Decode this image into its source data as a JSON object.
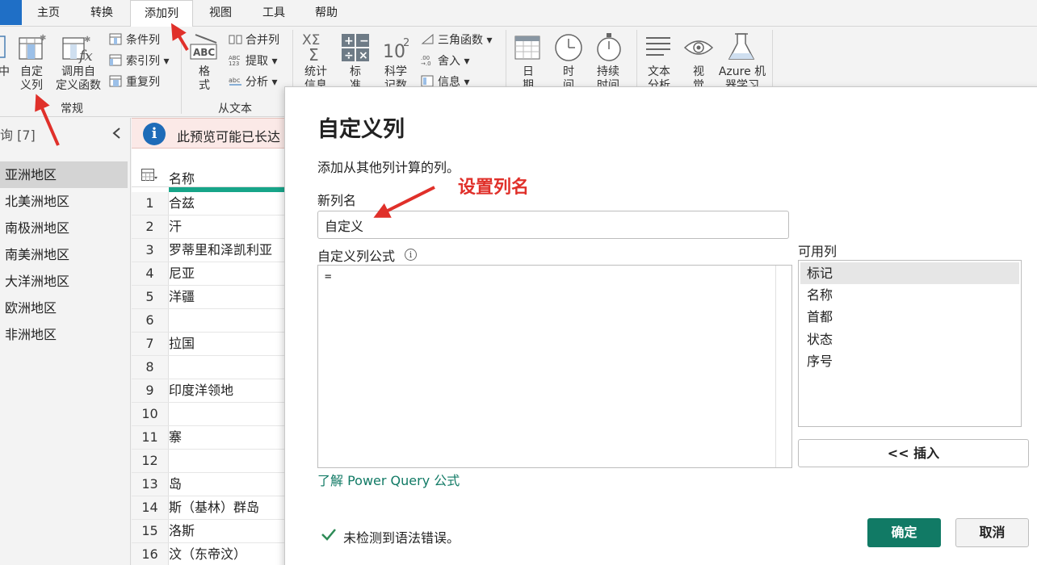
{
  "tabs": [
    {
      "label": "主页"
    },
    {
      "label": "转换"
    },
    {
      "label": "添加列"
    },
    {
      "label": "视图"
    },
    {
      "label": "工具"
    },
    {
      "label": "帮助"
    }
  ],
  "ribbon": {
    "partial_left": "中",
    "custom_column": "自定\n义列",
    "invoke_function": "调用自\n定义函数",
    "conditional_column": "条件列",
    "index_column": "索引列",
    "duplicate_column": "重复列",
    "general_group": "常规",
    "format": "格\n式",
    "merge_columns": "合并列",
    "extract": "提取",
    "parse": "分析",
    "from_text_group": "从文本",
    "statistics": "统计\n信息",
    "standard": "标\n准",
    "scientific": "科学\n记数",
    "trigonometry": "三角函数",
    "rounding": "舍入",
    "information": "信息",
    "date": "日\n期",
    "time": "时\n间",
    "duration": "持续\n时间",
    "text_analytics": "文本\n分析",
    "vision": "视\n觉",
    "azure_ml": "Azure 机\n器学习"
  },
  "left_panel": {
    "header": "询 [7]",
    "queries": [
      "亚洲地区",
      "北美洲地区",
      "南极洲地区",
      "南美洲地区",
      "大洋洲地区",
      "欧洲地区",
      "非洲地区"
    ]
  },
  "grid": {
    "info_text": "此预览可能已长达",
    "column_name": "名称",
    "rows": [
      {
        "num": "1",
        "value": "合兹"
      },
      {
        "num": "2",
        "value": "汗"
      },
      {
        "num": "3",
        "value": "罗蒂里和泽凯利亚"
      },
      {
        "num": "4",
        "value": "尼亚"
      },
      {
        "num": "5",
        "value": "洋疆"
      },
      {
        "num": "6",
        "value": ""
      },
      {
        "num": "7",
        "value": "拉国"
      },
      {
        "num": "8",
        "value": ""
      },
      {
        "num": "9",
        "value": "印度洋领地"
      },
      {
        "num": "10",
        "value": ""
      },
      {
        "num": "11",
        "value": "寨"
      },
      {
        "num": "12",
        "value": ""
      },
      {
        "num": "13",
        "value": "岛"
      },
      {
        "num": "14",
        "value": "斯（基林）群岛"
      },
      {
        "num": "15",
        "value": "洛斯"
      },
      {
        "num": "16",
        "value": "汶（东帝汶）"
      }
    ]
  },
  "dialog": {
    "title": "自定义列",
    "description": "添加从其他列计算的列。",
    "new_column_label": "新列名",
    "new_column_value": "自定义",
    "formula_label": "自定义列公式",
    "formula_value": "=",
    "learn_link": "了解 Power Query 公式",
    "available_label": "可用列",
    "available_columns": [
      "标记",
      "名称",
      "首都",
      "状态",
      "序号"
    ],
    "insert_button": "<< 插入",
    "syntax_status": "未检测到语法错误。",
    "ok_button": "确定",
    "cancel_button": "取消"
  },
  "annotation": {
    "label": "设置列名",
    "color": "#e0302a"
  },
  "colors": {
    "accent": "#117a65",
    "quality_bar": "#17a589",
    "file_tab": "#1f6fc6"
  }
}
